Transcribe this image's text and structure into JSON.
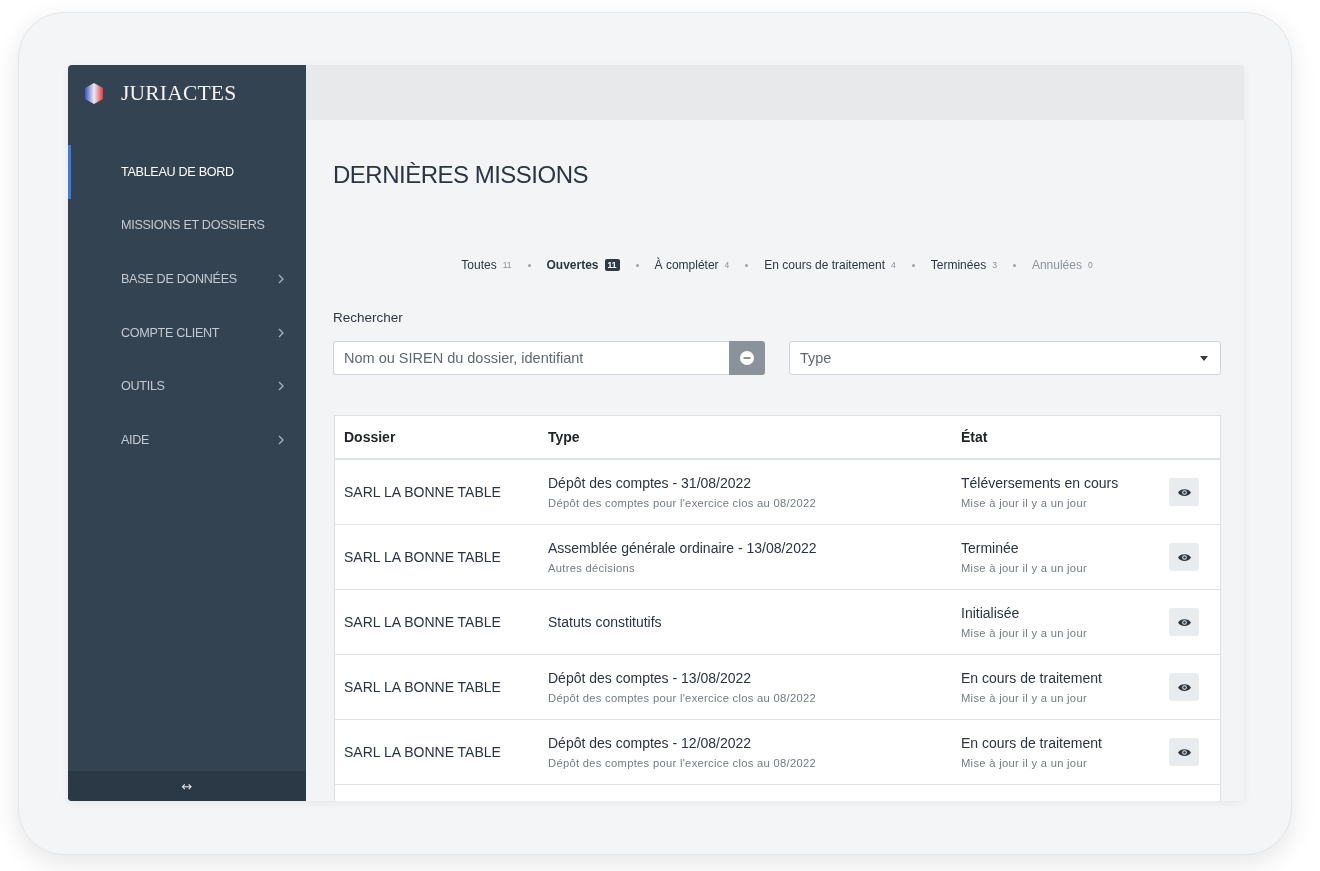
{
  "sidebar": {
    "brand": "JURIACTES",
    "items": [
      {
        "label": "TABLEAU DE BORD",
        "selected": true,
        "has_submenu": false
      },
      {
        "label": "MISSIONS ET DOSSIERS",
        "selected": false,
        "has_submenu": false
      },
      {
        "label": "BASE DE DONNÉES",
        "selected": false,
        "has_submenu": true
      },
      {
        "label": "COMPTE CLIENT",
        "selected": false,
        "has_submenu": true
      },
      {
        "label": "OUTILS",
        "selected": false,
        "has_submenu": true
      },
      {
        "label": "AIDE",
        "selected": false,
        "has_submenu": true
      }
    ],
    "toggle": "↔"
  },
  "page": {
    "title": "DERNIÈRES MISSIONS",
    "filters": [
      {
        "label": "Toutes",
        "count": "11",
        "selected": false,
        "disabled": false
      },
      {
        "label": "Ouvertes",
        "count": "11",
        "selected": true,
        "disabled": false
      },
      {
        "label": "À compléter",
        "count": "4",
        "selected": false,
        "disabled": false
      },
      {
        "label": "En cours de traitement",
        "count": "4",
        "selected": false,
        "disabled": false
      },
      {
        "label": "Terminées",
        "count": "3",
        "selected": false,
        "disabled": false
      },
      {
        "label": "Annulées",
        "count": "0",
        "selected": false,
        "disabled": true
      }
    ],
    "search": {
      "label": "Rechercher",
      "placeholder": "Nom ou SIREN du dossier, identifiant"
    },
    "type_filter": {
      "placeholder": "Type"
    },
    "table": {
      "columns": [
        "Dossier",
        "Type",
        "État"
      ],
      "rows": [
        {
          "dossier": "SARL LA BONNE TABLE",
          "type": "Dépôt des comptes - 31/08/2022",
          "type_detail": "Dépôt des comptes pour l'exercice clos au 08/2022",
          "status": "Téléversements en cours",
          "status_detail": "Mise à jour il y a un jour"
        },
        {
          "dossier": "SARL LA BONNE TABLE",
          "type": "Assemblée générale ordinaire - 13/08/2022",
          "type_detail": "Autres décisions",
          "status": "Terminée",
          "status_detail": "Mise à jour il y a un jour"
        },
        {
          "dossier": "SARL LA BONNE TABLE",
          "type": "Statuts constitutifs",
          "status": "Initialisée",
          "status_detail": "Mise à jour il y a un jour"
        },
        {
          "dossier": "SARL LA BONNE TABLE",
          "type": "Dépôt des comptes - 13/08/2022",
          "type_detail": "Dépôt des comptes pour l'exercice clos au 08/2022",
          "status": "En cours de traitement",
          "status_detail": "Mise à jour il y a un jour"
        },
        {
          "dossier": "SARL LA BONNE TABLE",
          "type": "Dépôt des comptes - 12/08/2022",
          "type_detail": "Dépôt des comptes pour l'exercice clos au 08/2022",
          "status": "En cours de traitement",
          "status_detail": "Mise à jour il y a un jour"
        }
      ]
    }
  }
}
